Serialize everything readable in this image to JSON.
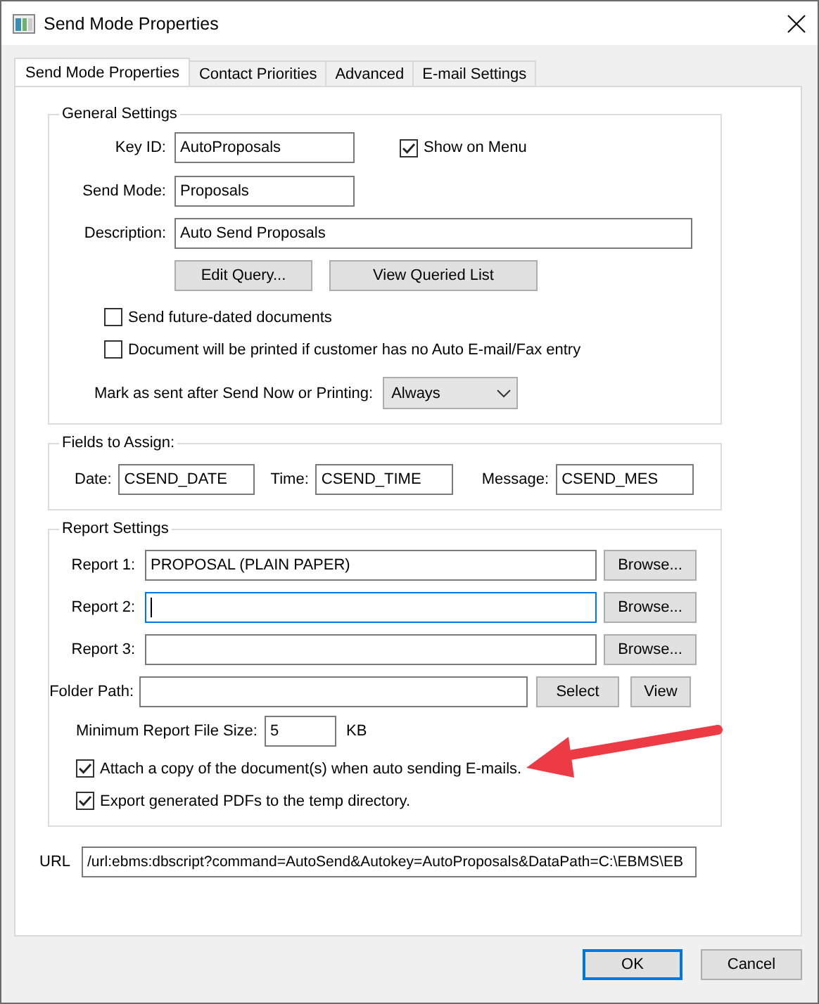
{
  "window": {
    "title": "Send Mode Properties"
  },
  "tabs": [
    {
      "label": "Send Mode Properties",
      "selected": true
    },
    {
      "label": "Contact Priorities",
      "selected": false
    },
    {
      "label": "Advanced",
      "selected": false
    },
    {
      "label": "E-mail Settings",
      "selected": false
    }
  ],
  "general_settings": {
    "title": "General Settings",
    "key_id": {
      "label": "Key ID:",
      "value": "AutoProposals"
    },
    "show_on_menu": {
      "label": "Show on Menu",
      "checked": true
    },
    "send_mode": {
      "label": "Send Mode:",
      "value": "Proposals"
    },
    "description": {
      "label": "Description:",
      "value": "Auto Send Proposals"
    },
    "buttons": [
      "Edit Query...",
      "View Queried List"
    ],
    "options": [
      {
        "label": "Send future-dated documents",
        "checked": false
      },
      {
        "label": "Document will be printed if customer has no Auto E-mail/Fax entry",
        "checked": false
      }
    ],
    "mark_as_sent": {
      "label": "Mark as sent after Send Now or Printing:",
      "value": "Always"
    }
  },
  "fields_to_assign": {
    "title": "Fields to Assign:",
    "fields": [
      {
        "label": "Date:",
        "value": "CSEND_DATE"
      },
      {
        "label": "Time:",
        "value": "CSEND_TIME"
      },
      {
        "label": "Message:",
        "value": "CSEND_MES"
      }
    ]
  },
  "report_settings": {
    "title": "Report Settings",
    "reports": [
      {
        "label": "Report 1:",
        "value": "PROPOSAL (PLAIN PAPER)",
        "focused": false,
        "button": "Browse..."
      },
      {
        "label": "Report 2:",
        "focused": true,
        "button": "Browse..."
      },
      {
        "label": "Report 3:",
        "focused": false,
        "button": "Browse..."
      }
    ],
    "folder_path": {
      "label": "Folder Path:",
      "buttons": [
        "Select",
        "View"
      ]
    },
    "min_file_size": {
      "label": "Minimum Report File Size:",
      "value": "5",
      "unit": "KB"
    },
    "options": [
      {
        "label": "Attach a copy of the document(s) when auto sending E-mails.",
        "checked": true
      },
      {
        "label": "Export generated PDFs to the temp directory.",
        "checked": true
      }
    ]
  },
  "url": {
    "label": "URL",
    "value": "/url:ebms:dbscript?command=AutoSend&Autokey=AutoProposals&DataPath=C:\\EBMS\\EB"
  },
  "buttons": [
    {
      "label": "OK",
      "default": true
    },
    {
      "label": "Cancel",
      "default": false
    }
  ]
}
